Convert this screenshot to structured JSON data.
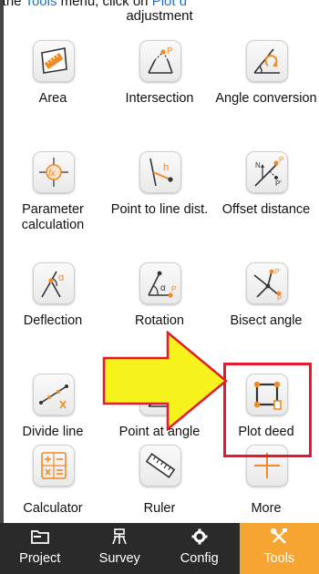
{
  "caption": {
    "line1_prefix": "In the ",
    "line1_link1": "Tools",
    "line1_mid": " menu, click on ",
    "line1_link2": "Plot d",
    "line2": "adjustment"
  },
  "tools": [
    {
      "id": "area",
      "label": "Area",
      "icon": "area-icon"
    },
    {
      "id": "intersection",
      "label": "Intersection",
      "icon": "intersection-icon"
    },
    {
      "id": "angle-conversion",
      "label": "Angle conversion",
      "icon": "angle-conversion-icon"
    },
    {
      "id": "parameter-calculation",
      "label": "Parameter calculation",
      "icon": "parameter-calculation-icon"
    },
    {
      "id": "point-to-line-dist",
      "label": "Point to line dist.",
      "icon": "point-to-line-icon"
    },
    {
      "id": "offset-distance",
      "label": "Offset distance",
      "icon": "offset-distance-icon"
    },
    {
      "id": "deflection",
      "label": "Deflection",
      "icon": "deflection-icon"
    },
    {
      "id": "rotation",
      "label": "Rotation",
      "icon": "rotation-icon"
    },
    {
      "id": "bisect-angle",
      "label": "Bisect angle",
      "icon": "bisect-angle-icon"
    },
    {
      "id": "divide-line",
      "label": "Divide line",
      "icon": "divide-line-icon"
    },
    {
      "id": "point-at-angle",
      "label": "Point at angle",
      "icon": "point-at-angle-icon"
    },
    {
      "id": "plot-deed",
      "label": "Plot deed",
      "icon": "plot-deed-icon"
    },
    {
      "id": "calculator",
      "label": "Calculator",
      "icon": "calculator-icon"
    },
    {
      "id": "ruler",
      "label": "Ruler",
      "icon": "ruler-icon"
    },
    {
      "id": "more",
      "label": "More",
      "icon": "plus-icon"
    }
  ],
  "icon_glyphs": {
    "area": "",
    "intersection": "P",
    "parameter": "fx",
    "point_to_line": "h",
    "offset_n": "N",
    "offset_p": "P",
    "offset_p2": "P'",
    "deflection": "α",
    "rotation_a": "α",
    "rotation_p": "P",
    "bisect_p": "P'",
    "bisect_p2": "P"
  },
  "nav": [
    {
      "id": "project",
      "label": "Project",
      "icon": "folder-icon",
      "active": false
    },
    {
      "id": "survey",
      "label": "Survey",
      "icon": "survey-icon",
      "active": false
    },
    {
      "id": "config",
      "label": "Config",
      "icon": "gear-icon",
      "active": false
    },
    {
      "id": "tools",
      "label": "Tools",
      "icon": "tools-icon",
      "active": true
    }
  ],
  "colors": {
    "accent_orange": "#f6a532",
    "icon_orange": "#f08a24",
    "highlight_red": "#e21b2a",
    "arrow_yellow": "#f5f21c",
    "nav_bg": "#2a2a2a",
    "link_blue": "#1a73c9"
  }
}
